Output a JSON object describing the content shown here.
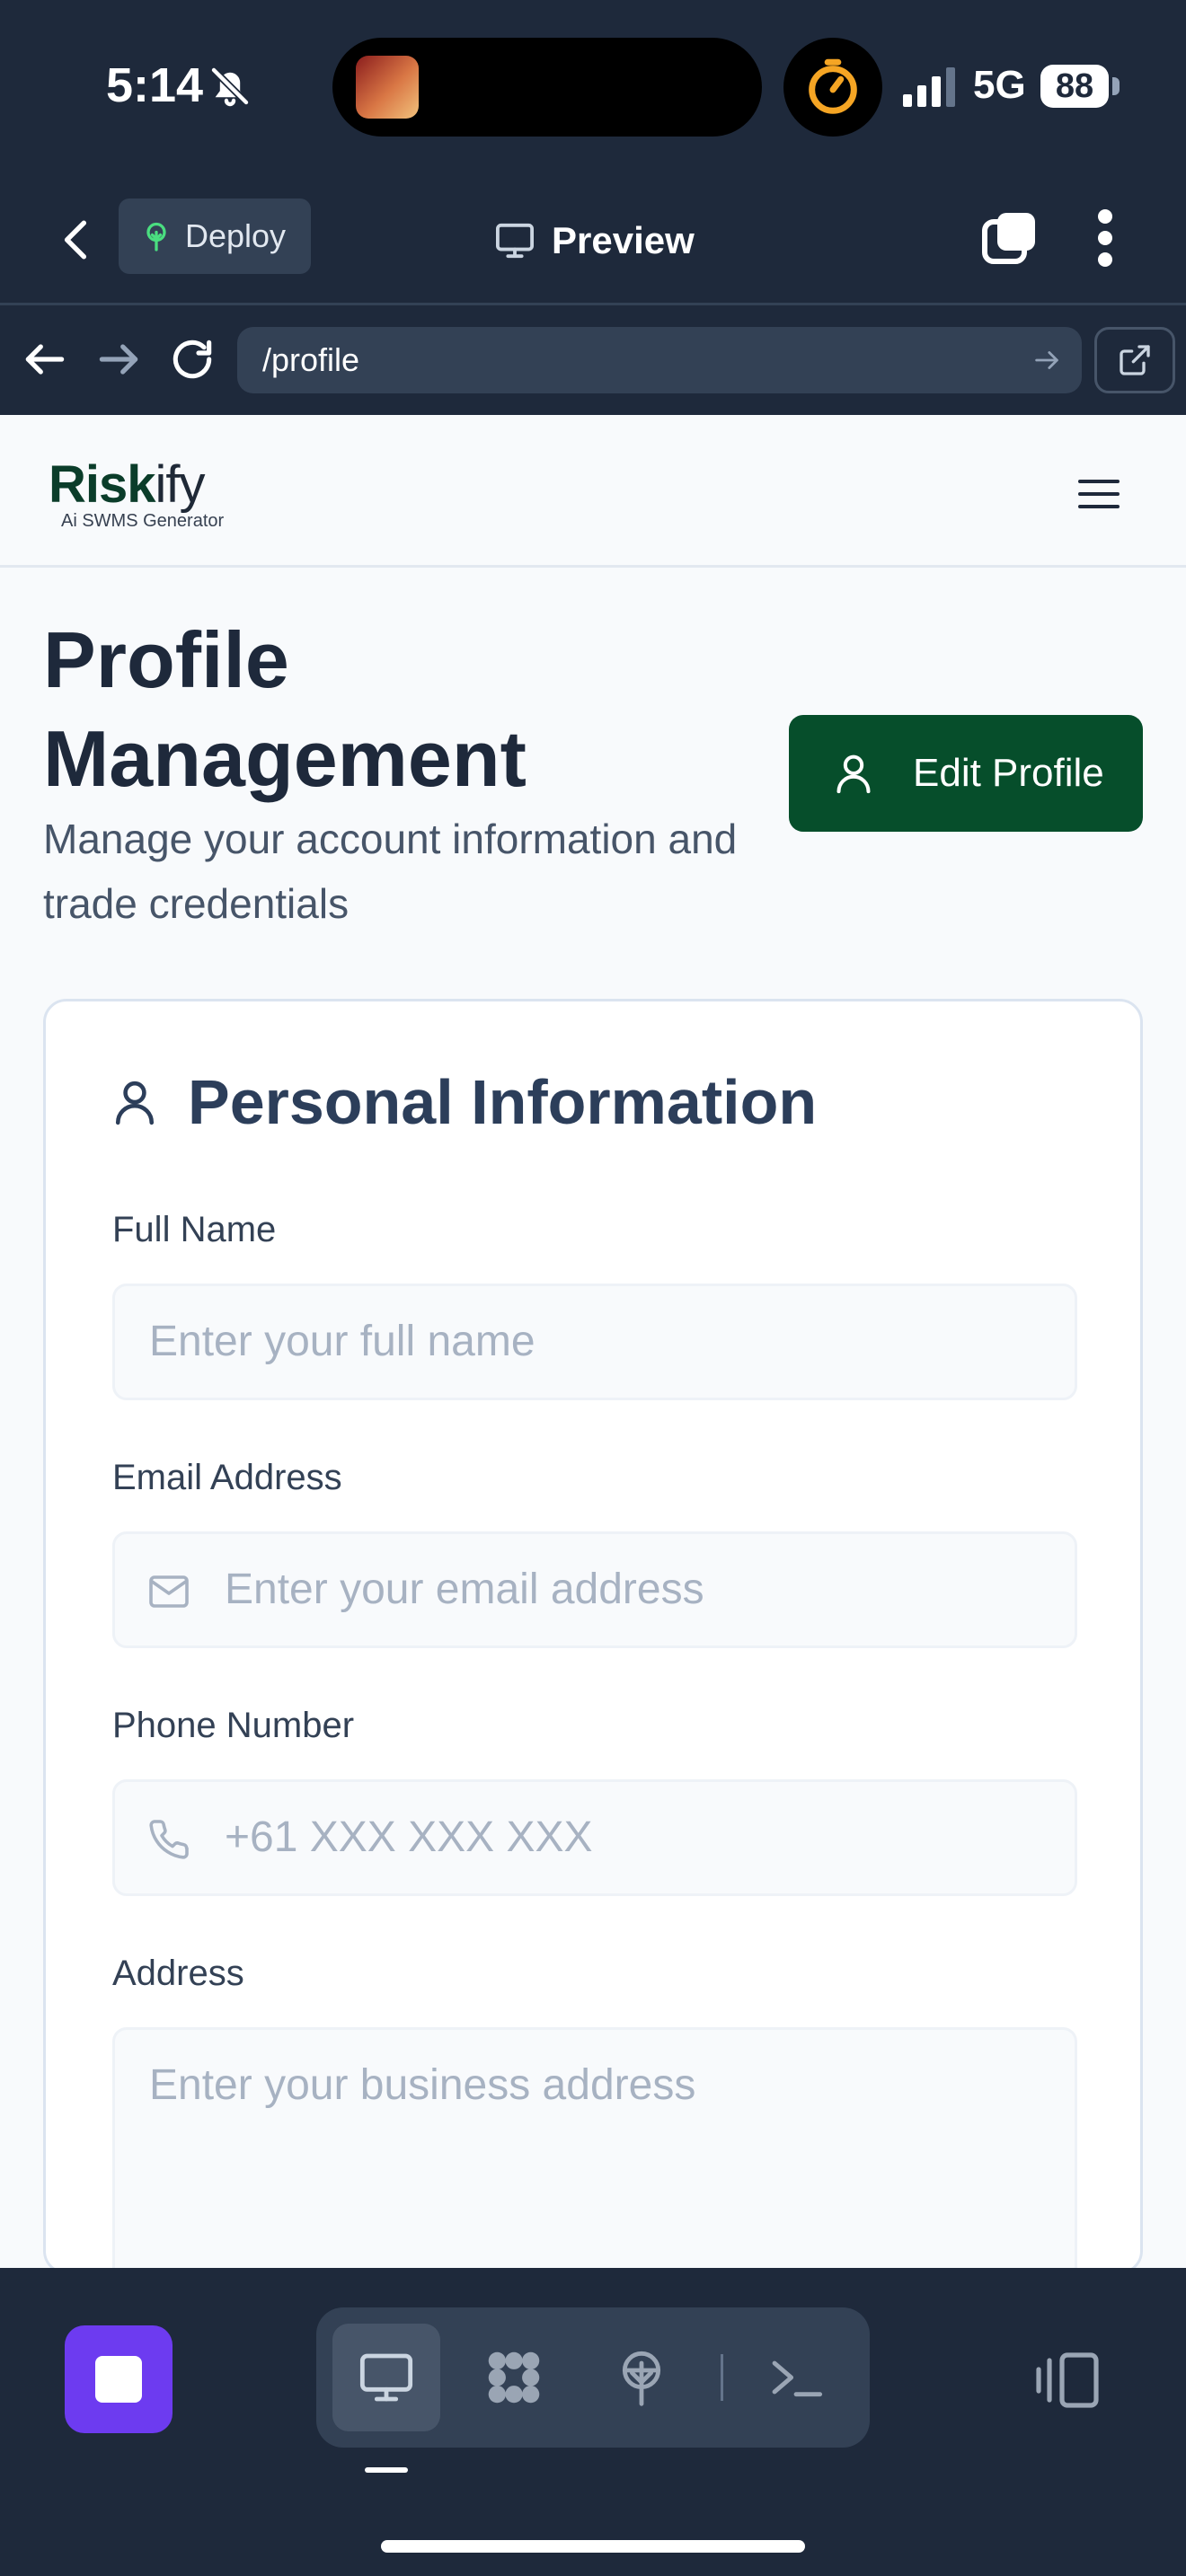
{
  "status_bar": {
    "time": "5:14",
    "network": "5G",
    "battery": "88"
  },
  "app_bar": {
    "deploy_label": "Deploy",
    "preview_label": "Preview"
  },
  "url_bar": {
    "path": "/profile"
  },
  "site": {
    "logo_main": "Risk",
    "logo_suffix": "ify",
    "logo_tagline": "Ai SWMS Generator"
  },
  "page": {
    "title": "Profile Management",
    "subtitle": "Manage your account information and trade credentials",
    "edit_button": "Edit Profile"
  },
  "personal_info": {
    "heading": "Personal Information",
    "full_name": {
      "label": "Full Name",
      "placeholder": "Enter your full name"
    },
    "email": {
      "label": "Email Address",
      "placeholder": "Enter your email address"
    },
    "phone": {
      "label": "Phone Number",
      "placeholder": "+61 XXX XXX XXX"
    },
    "address": {
      "label": "Address",
      "placeholder": "Enter your business address"
    }
  },
  "icons": {
    "bell": "bell-slash-icon",
    "timer": "stopwatch-icon",
    "back": "chevron-left-icon",
    "deploy": "deploy-tree-icon",
    "preview": "monitor-icon",
    "tabs": "tabs-icon",
    "more": "more-vertical-icon",
    "reload": "reload-icon",
    "external": "external-link-icon",
    "menu": "hamburger-icon",
    "user": "user-icon",
    "mail": "mail-icon",
    "phone": "phone-icon"
  },
  "colors": {
    "brand_green": "#064e2b",
    "dark_chrome": "#1e293b",
    "accent_purple": "#6d3bf0"
  }
}
